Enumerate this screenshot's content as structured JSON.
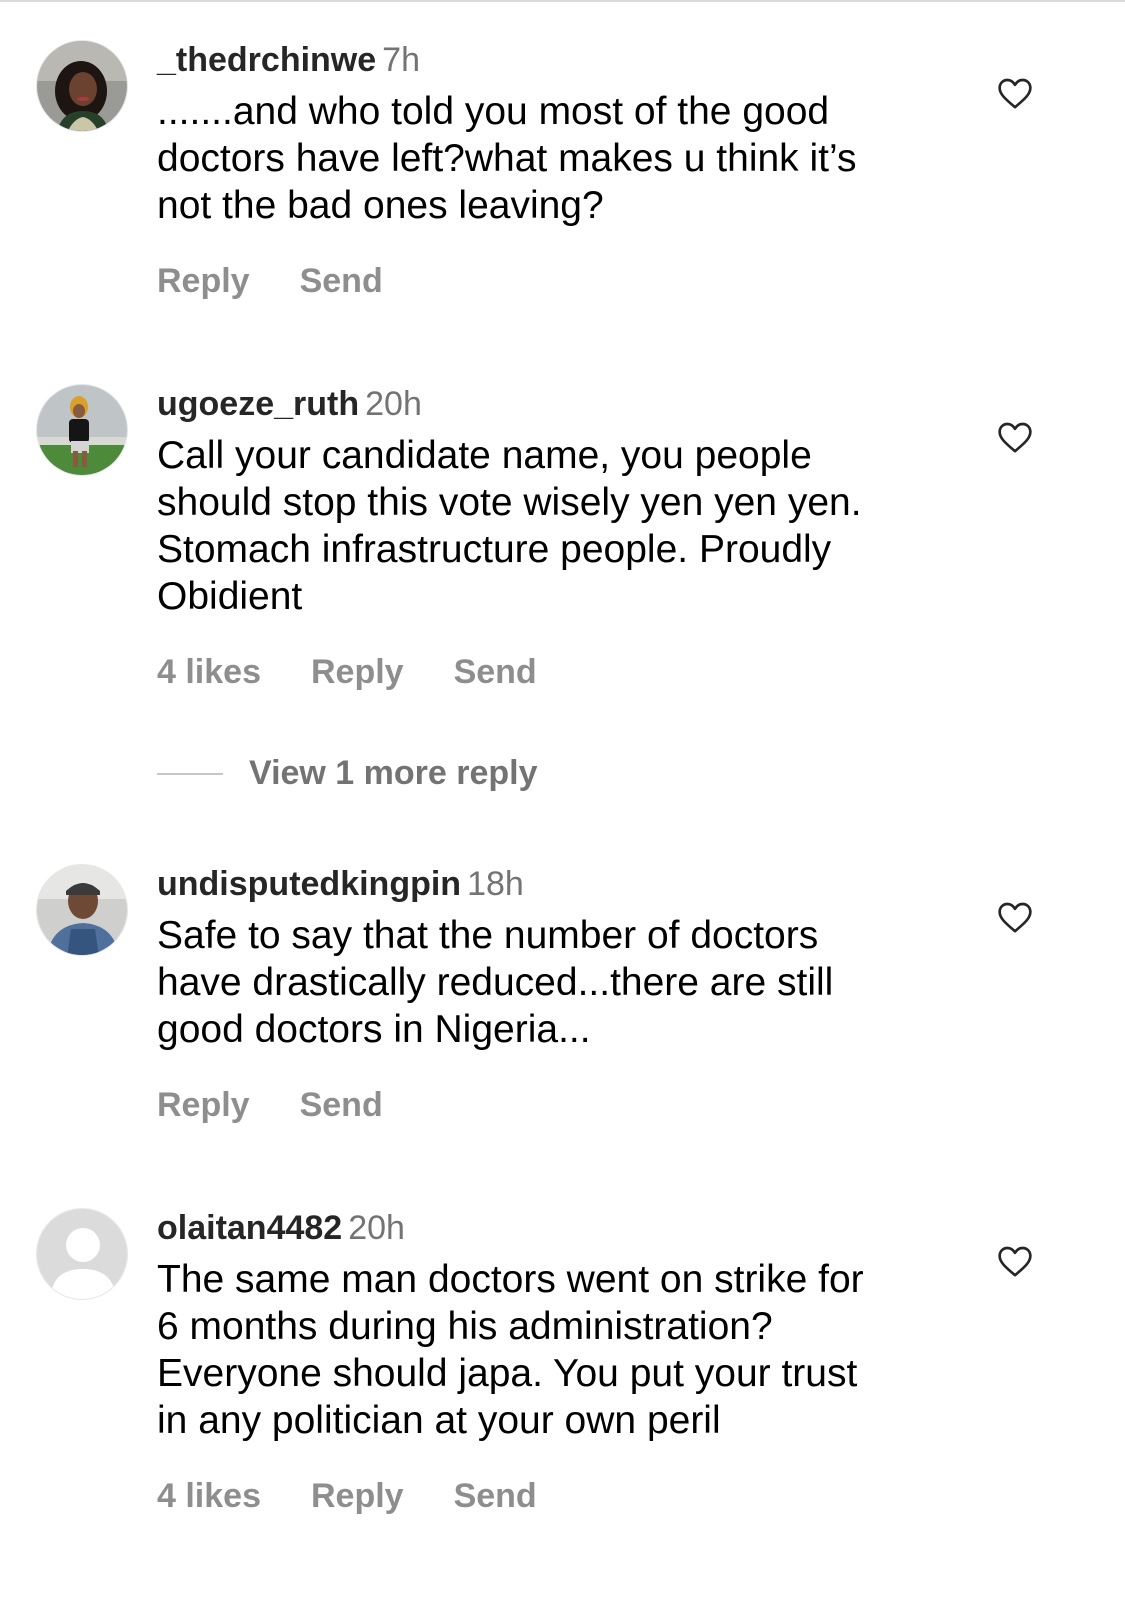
{
  "comments": [
    {
      "username": "_thedrchinwe",
      "time": "7h",
      "lines": [
        ".......and who told you most of the good",
        "doctors have left?what makes u think it’s",
        "not the bad ones leaving?"
      ],
      "likes": "",
      "reply_label": "Reply",
      "send_label": "Send",
      "avatar_icon": "profile-photo"
    },
    {
      "username": "ugoeze_ruth",
      "time": "20h",
      "lines": [
        "Call your candidate name, you people",
        "should stop this vote wisely yen yen yen.",
        "Stomach infrastructure people. Proudly",
        "Obidient"
      ],
      "likes": "4 likes",
      "reply_label": "Reply",
      "send_label": "Send",
      "avatar_icon": "profile-photo"
    },
    {
      "username": "undisputedkingpin",
      "time": "18h",
      "lines": [
        "Safe to say that the number of doctors",
        "have drastically reduced...there are still",
        "good doctors in Nigeria..."
      ],
      "likes": "",
      "reply_label": "Reply",
      "send_label": "Send",
      "avatar_icon": "profile-photo"
    },
    {
      "username": "olaitan4482",
      "time": "20h",
      "lines": [
        "The same man doctors went on strike for",
        "6 months during his administration?",
        "Everyone should japa. You put your trust",
        "in any politician at your own peril"
      ],
      "likes": "4 likes",
      "reply_label": "Reply",
      "send_label": "Send",
      "avatar_icon": "default-avatar"
    }
  ],
  "view_more_replies": "View 1 more reply",
  "icons": {
    "like": "heart-outline-icon"
  },
  "colors": {
    "username": "#262626",
    "timestamp": "#737373",
    "action_text": "#8e8e8e",
    "comment_text": "#000000",
    "background": "#ffffff"
  }
}
